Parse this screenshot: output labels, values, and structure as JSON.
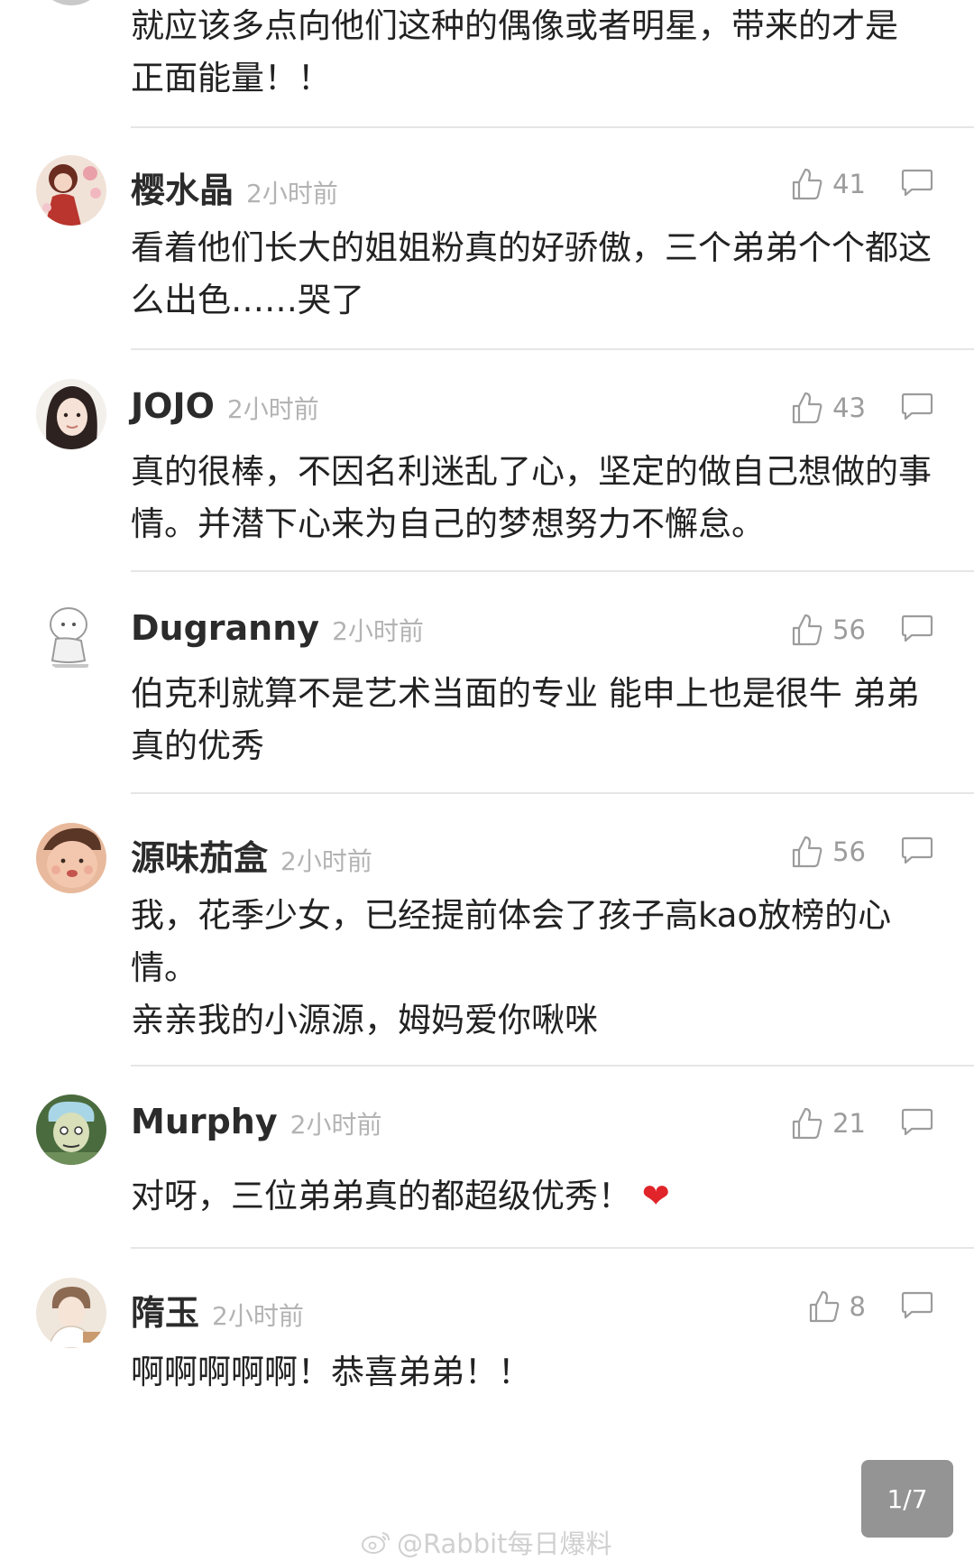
{
  "top_comment": {
    "text": "就应该多点向他们这种的偶像或者明星，带来的才是正面能量！！"
  },
  "comments": [
    {
      "username": "樱水晶",
      "time": "2小时前",
      "likes": "41",
      "text": "看着他们长大的姐姐粉真的好骄傲，三个弟弟个个都这么出色……哭了"
    },
    {
      "username": "JOJO",
      "time": "2小时前",
      "likes": "43",
      "text": "真的很棒，不因名利迷乱了心，坚定的做自己想做的事情。并潜下心来为自己的梦想努力不懈怠。"
    },
    {
      "username": "Dugranny",
      "time": "2小时前",
      "likes": "56",
      "text": "伯克利就算不是艺术当面的专业 能申上也是很牛 弟弟真的优秀"
    },
    {
      "username": "源味茄盒",
      "time": "2小时前",
      "likes": "56",
      "text_line1": "我，花季少女，已经提前体会了孩子高kao放榜的心情。",
      "text_line2": "亲亲我的小源源，姆妈爱你啾咪"
    },
    {
      "username": "Murphy",
      "time": "2小时前",
      "likes": "21",
      "text": "对呀，三位弟弟真的都超级优秀！",
      "emoji": "❤"
    },
    {
      "username": "隋玉",
      "time": "2小时前",
      "likes": "8",
      "text": "啊啊啊啊啊！恭喜弟弟！！"
    }
  ],
  "page_indicator": "1/7",
  "watermark": "@Rabbit每日爆料",
  "icons": {
    "like": "thumbs-up-icon",
    "reply": "comment-bubble-icon",
    "watermark": "weibo-logo-icon"
  },
  "colors": {
    "text": "#222222",
    "meta": "#b3b3b3",
    "icon": "#9c9c9c",
    "divider": "#e6e6e6",
    "heart": "#e0242a"
  }
}
